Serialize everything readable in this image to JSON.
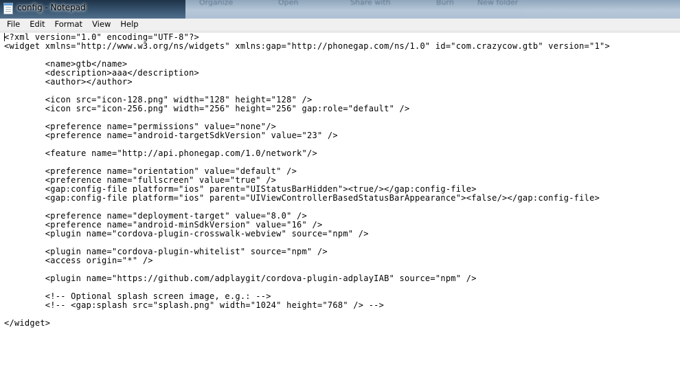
{
  "window": {
    "title": "config - Notepad"
  },
  "menu": {
    "items": [
      "File",
      "Edit",
      "Format",
      "View",
      "Help"
    ]
  },
  "background_blur_words": [
    "Organize",
    "Open",
    "Share with",
    "Burn",
    "New folder"
  ],
  "editor": {
    "text": "<?xml version=\"1.0\" encoding=\"UTF-8\"?>\n<widget xmlns=\"http://www.w3.org/ns/widgets\" xmlns:gap=\"http://phonegap.com/ns/1.0\" id=\"com.crazycow.gtb\" version=\"1\">\n\n        <name>gtb</name>\n        <description>aaa</description>\n        <author></author>\n\n        <icon src=\"icon-128.png\" width=\"128\" height=\"128\" />\n        <icon src=\"icon-256.png\" width=\"256\" height=\"256\" gap:role=\"default\" />\n\n        <preference name=\"permissions\" value=\"none\"/>\n        <preference name=\"android-targetSdkVersion\" value=\"23\" />\n\n        <feature name=\"http://api.phonegap.com/1.0/network\"/>\n\n        <preference name=\"orientation\" value=\"default\" />\n        <preference name=\"fullscreen\" value=\"true\" />\n        <gap:config-file platform=\"ios\" parent=\"UIStatusBarHidden\"><true/></gap:config-file>\n        <gap:config-file platform=\"ios\" parent=\"UIViewControllerBasedStatusBarAppearance\"><false/></gap:config-file>\n\n        <preference name=\"deployment-target\" value=\"8.0\" />\n        <preference name=\"android-minSdkVersion\" value=\"16\" />\n        <plugin name=\"cordova-plugin-crosswalk-webview\" source=\"npm\" />\n\n        <plugin name=\"cordova-plugin-whitelist\" source=\"npm\" />\n        <access origin=\"*\" />\n\n        <plugin name=\"https://github.com/adplaygit/cordova-plugin-adplayIAB\" source=\"npm\" />\n\n        <!-- Optional splash screen image, e.g.: -->\n        <!-- <gap:splash src=\"splash.png\" width=\"1024\" height=\"768\" /> -->\n\n</widget>"
  }
}
